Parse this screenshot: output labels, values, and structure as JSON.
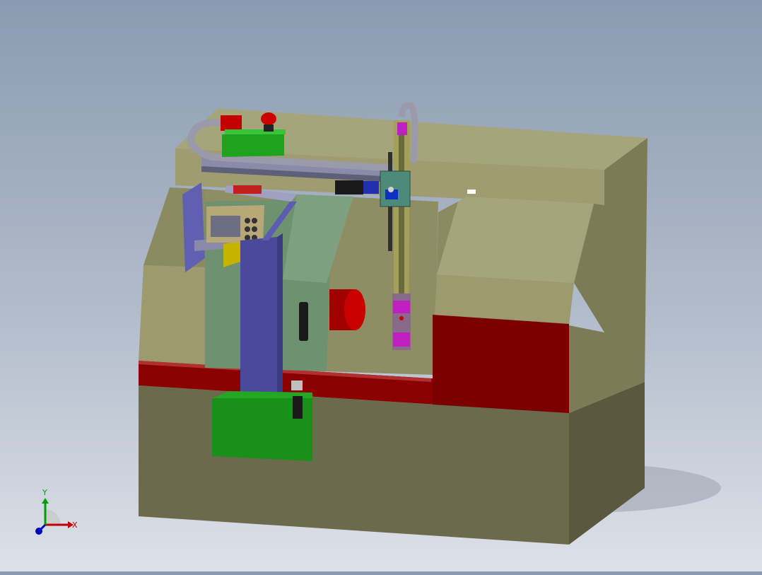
{
  "viewport": {
    "background_top": "#8a9bb1",
    "background_bottom": "#dde1e8"
  },
  "model": {
    "parts": [
      "machine-base",
      "machine-enclosure",
      "red-trim-band",
      "gantry-beam",
      "cable-chain",
      "control-pendant",
      "support-column",
      "column-base-green",
      "vertical-axis-arm",
      "gripper",
      "spindle-motor",
      "signal-lamp",
      "servo-motor"
    ],
    "colors": {
      "body": "#9c9a6e",
      "body_dark": "#6b6a4c",
      "trim_red": "#8b0000",
      "column_blue": "#4c4c9c",
      "green_part": "#1a8f1a",
      "panel_green": "#6e9270",
      "motor_red": "#b80000"
    }
  },
  "triad": {
    "x_label": "X",
    "y_label": "Y",
    "x_color": "#c00000",
    "y_color": "#00a000",
    "z_color": "#0000c0"
  }
}
